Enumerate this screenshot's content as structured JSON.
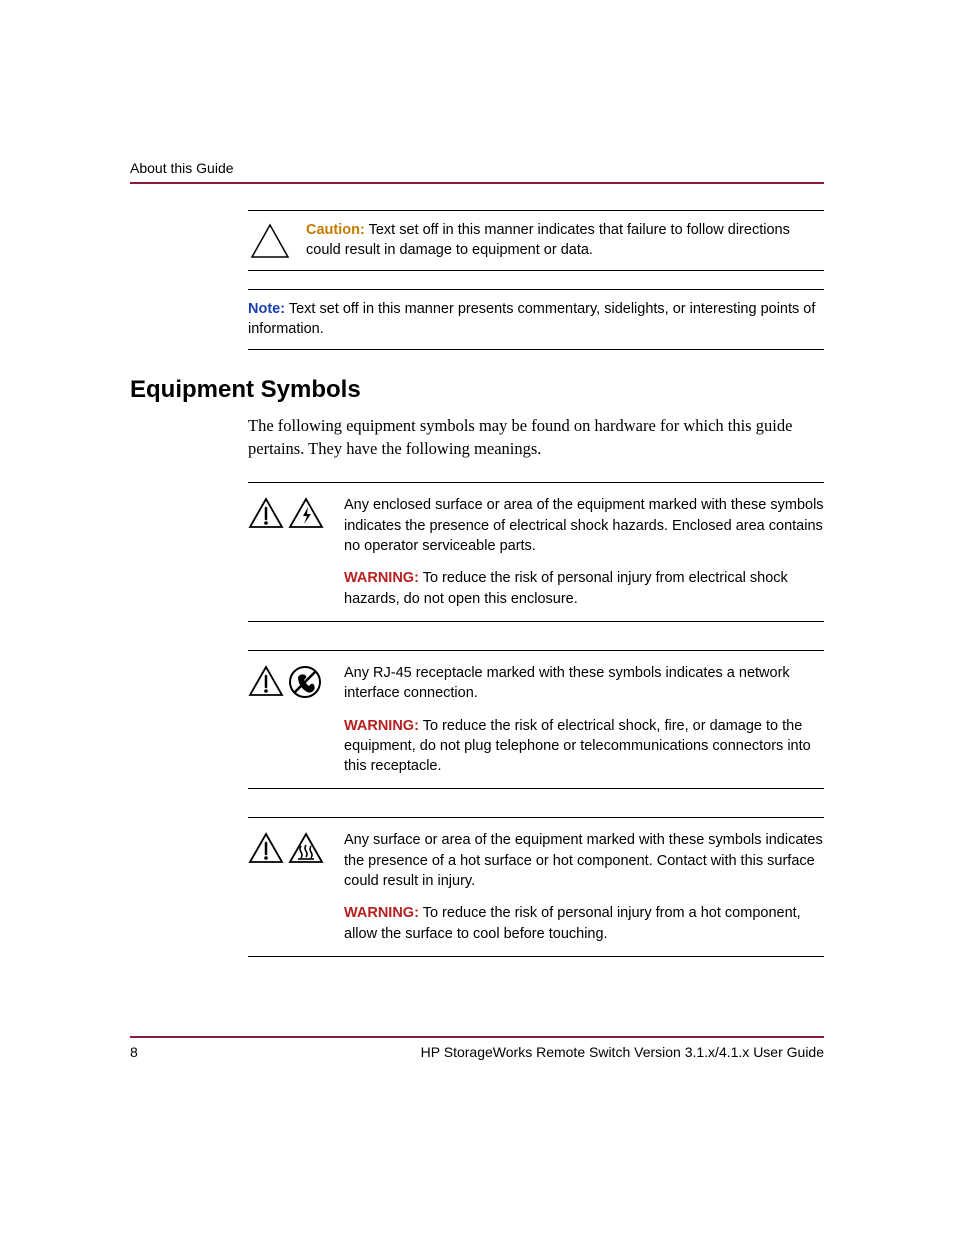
{
  "header": {
    "running_head": "About this Guide"
  },
  "caution": {
    "label": "Caution:",
    "text": "Text set off in this manner indicates that failure to follow directions could result in damage to equipment or data."
  },
  "note": {
    "label": "Note:",
    "text": "Text set off in this manner presents commentary, sidelights, or interesting points of information."
  },
  "section_title": "Equipment Symbols",
  "intro": "The following equipment symbols may be found on hardware for which this guide pertains. They have the following meanings.",
  "symbols": {
    "shock": {
      "desc": "Any enclosed surface or area of the equipment marked with these symbols indicates the presence of electrical shock hazards. Enclosed area contains no operator serviceable parts.",
      "warn_label": "WARNING:",
      "warn_text": "To reduce the risk of personal injury from electrical shock hazards, do not open this enclosure."
    },
    "rj45": {
      "desc": "Any RJ-45 receptacle marked with these symbols indicates a network interface connection.",
      "warn_label": "WARNING:",
      "warn_text": "To reduce the risk of electrical shock, fire, or damage to the equipment, do not plug telephone or telecommunications connectors into this receptacle."
    },
    "hot": {
      "desc": "Any surface or area of the equipment marked with these symbols indicates the presence of a hot surface or hot component. Contact with this surface could result in injury.",
      "warn_label": "WARNING:",
      "warn_text": "To reduce the risk of personal injury from a hot component, allow the surface to cool before touching."
    }
  },
  "footer": {
    "page_number": "8",
    "doc_title": "HP StorageWorks Remote Switch Version 3.1.x/4.1.x User Guide"
  }
}
